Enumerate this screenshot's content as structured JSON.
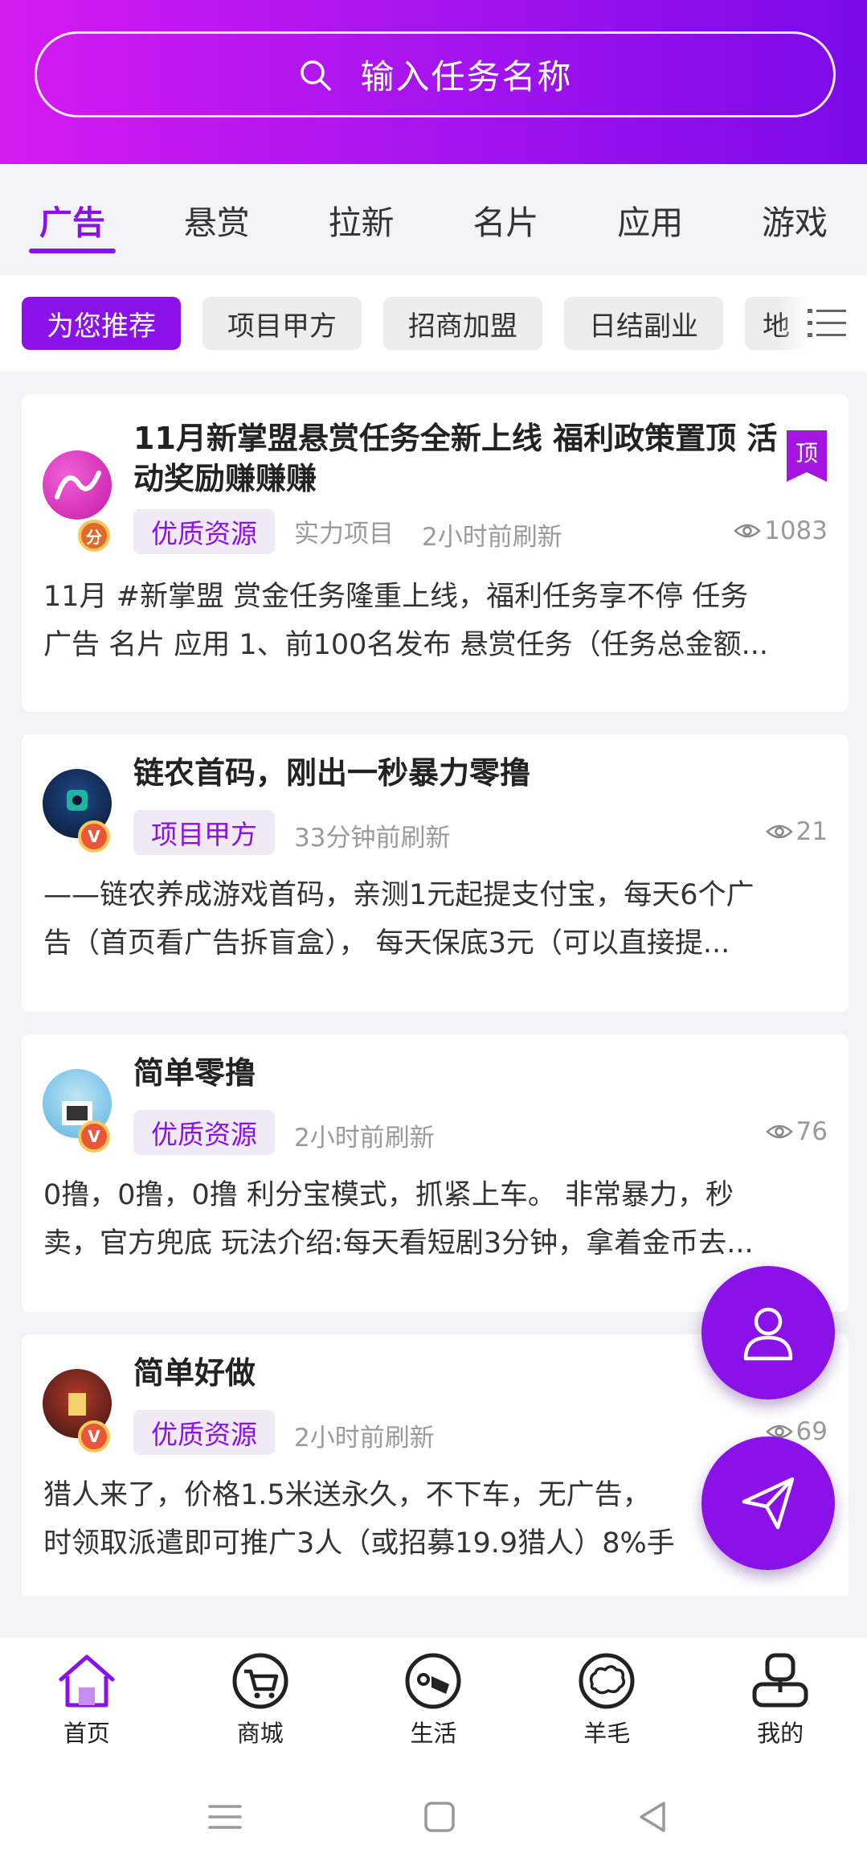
{
  "search": {
    "placeholder": "输入任务名称"
  },
  "tabs": [
    {
      "label": "广告",
      "active": true
    },
    {
      "label": "悬赏"
    },
    {
      "label": "拉新"
    },
    {
      "label": "名片"
    },
    {
      "label": "应用"
    },
    {
      "label": "游戏"
    }
  ],
  "chips": [
    {
      "label": "为您推荐",
      "active": true
    },
    {
      "label": "项目甲方"
    },
    {
      "label": "招商加盟"
    },
    {
      "label": "日结副业"
    },
    {
      "label": "地"
    }
  ],
  "cards": [
    {
      "title_line1": "11月新掌盟悬赏任务全新上线 福利政策置顶 活",
      "title_line2": "动奖励赚赚赚",
      "tag": "优质资源",
      "meta1": "实力项目",
      "meta2": "2小时前刷新",
      "views": "1083",
      "top_badge": "顶",
      "badge": "分",
      "desc_line1": "11月 #新掌盟 赏金任务隆重上线，福利任务享不停 任务",
      "desc_line2": "广告 名片 应用 1、前100名发布 悬赏任务（任务总金额..."
    },
    {
      "title_line1": "链农首码，刚出一秒暴力零撸",
      "tag": "项目甲方",
      "meta1": "33分钟前刷新",
      "views": "21",
      "badge": "V",
      "desc_line1": "——链农养成游戏首码，亲测1元起提支付宝，每天6个广",
      "desc_line2": "告（首页看广告拆盲盒）， 每天保底3元（可以直接提..."
    },
    {
      "title_line1": "简单零撸",
      "tag": "优质资源",
      "meta1": "2小时前刷新",
      "views": "76",
      "badge": "V",
      "desc_line1": "0撸，0撸，0撸 利分宝模式，抓紧上车。 非常暴力，秒",
      "desc_line2": "卖，官方兜底 玩法介绍:每天看短剧3分钟，拿着金币去..."
    },
    {
      "title_line1": "简单好做",
      "tag": "优质资源",
      "meta1": "2小时前刷新",
      "views": "69",
      "badge": "V",
      "desc_line1": "猎人来了，价格1.5米送永久，不下车，无广告，",
      "desc_line2": "时领取派遣即可推广3人（或招募19.9猎人）8%手"
    }
  ],
  "nav": [
    {
      "label": "首页",
      "icon": "home-icon",
      "active": true
    },
    {
      "label": "商城",
      "icon": "cart-icon"
    },
    {
      "label": "生活",
      "icon": "life-icon"
    },
    {
      "label": "羊毛",
      "icon": "sheep-icon"
    },
    {
      "label": "我的",
      "icon": "profile-icon"
    }
  ],
  "colors": {
    "accent": "#8a11e8",
    "header_start": "#d41bf0",
    "header_end": "#7a0ae8"
  }
}
